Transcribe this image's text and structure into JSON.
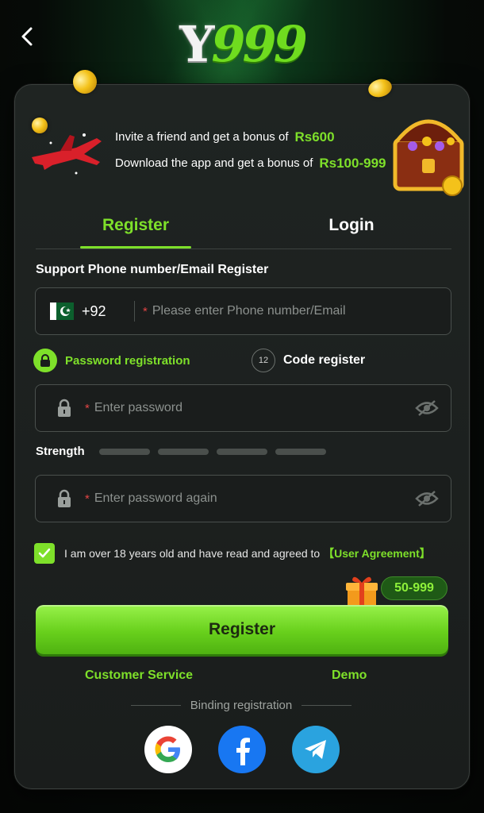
{
  "header": {
    "logo_y": "Y",
    "logo_num": "999"
  },
  "promo": {
    "line1_text": "Invite a friend and get a bonus of",
    "line1_amount": "Rs600",
    "line2_text": "Download the app and get a bonus of",
    "line2_amount": "Rs100-999"
  },
  "tabs": {
    "register": "Register",
    "login": "Login",
    "active": "register"
  },
  "form": {
    "section_title": "Support Phone number/Email Register",
    "country_code": "+92",
    "required_mark": "*",
    "phone_placeholder": "Please enter Phone number/Email",
    "reg_password_label": "Password registration",
    "reg_code_label": "Code register",
    "reg_code_badge": "12",
    "password_placeholder": "Enter password",
    "strength_label": "Strength",
    "strength_level": 0,
    "strength_segments": 4,
    "password_again_placeholder": "Enter password again",
    "agree_checked": true,
    "agree_text": "I am over 18 years old and have read and agreed to",
    "agree_link": "【User Agreement】",
    "bonus_badge": "50-999",
    "register_button": "Register"
  },
  "footer": {
    "customer_service": "Customer Service",
    "demo": "Demo",
    "binding_text": "Binding registration",
    "socials": [
      "google-icon",
      "facebook-icon",
      "telegram-icon"
    ]
  },
  "colors": {
    "accent": "#7ee02a",
    "card_bg": "#1f2422",
    "required": "#e24545"
  }
}
